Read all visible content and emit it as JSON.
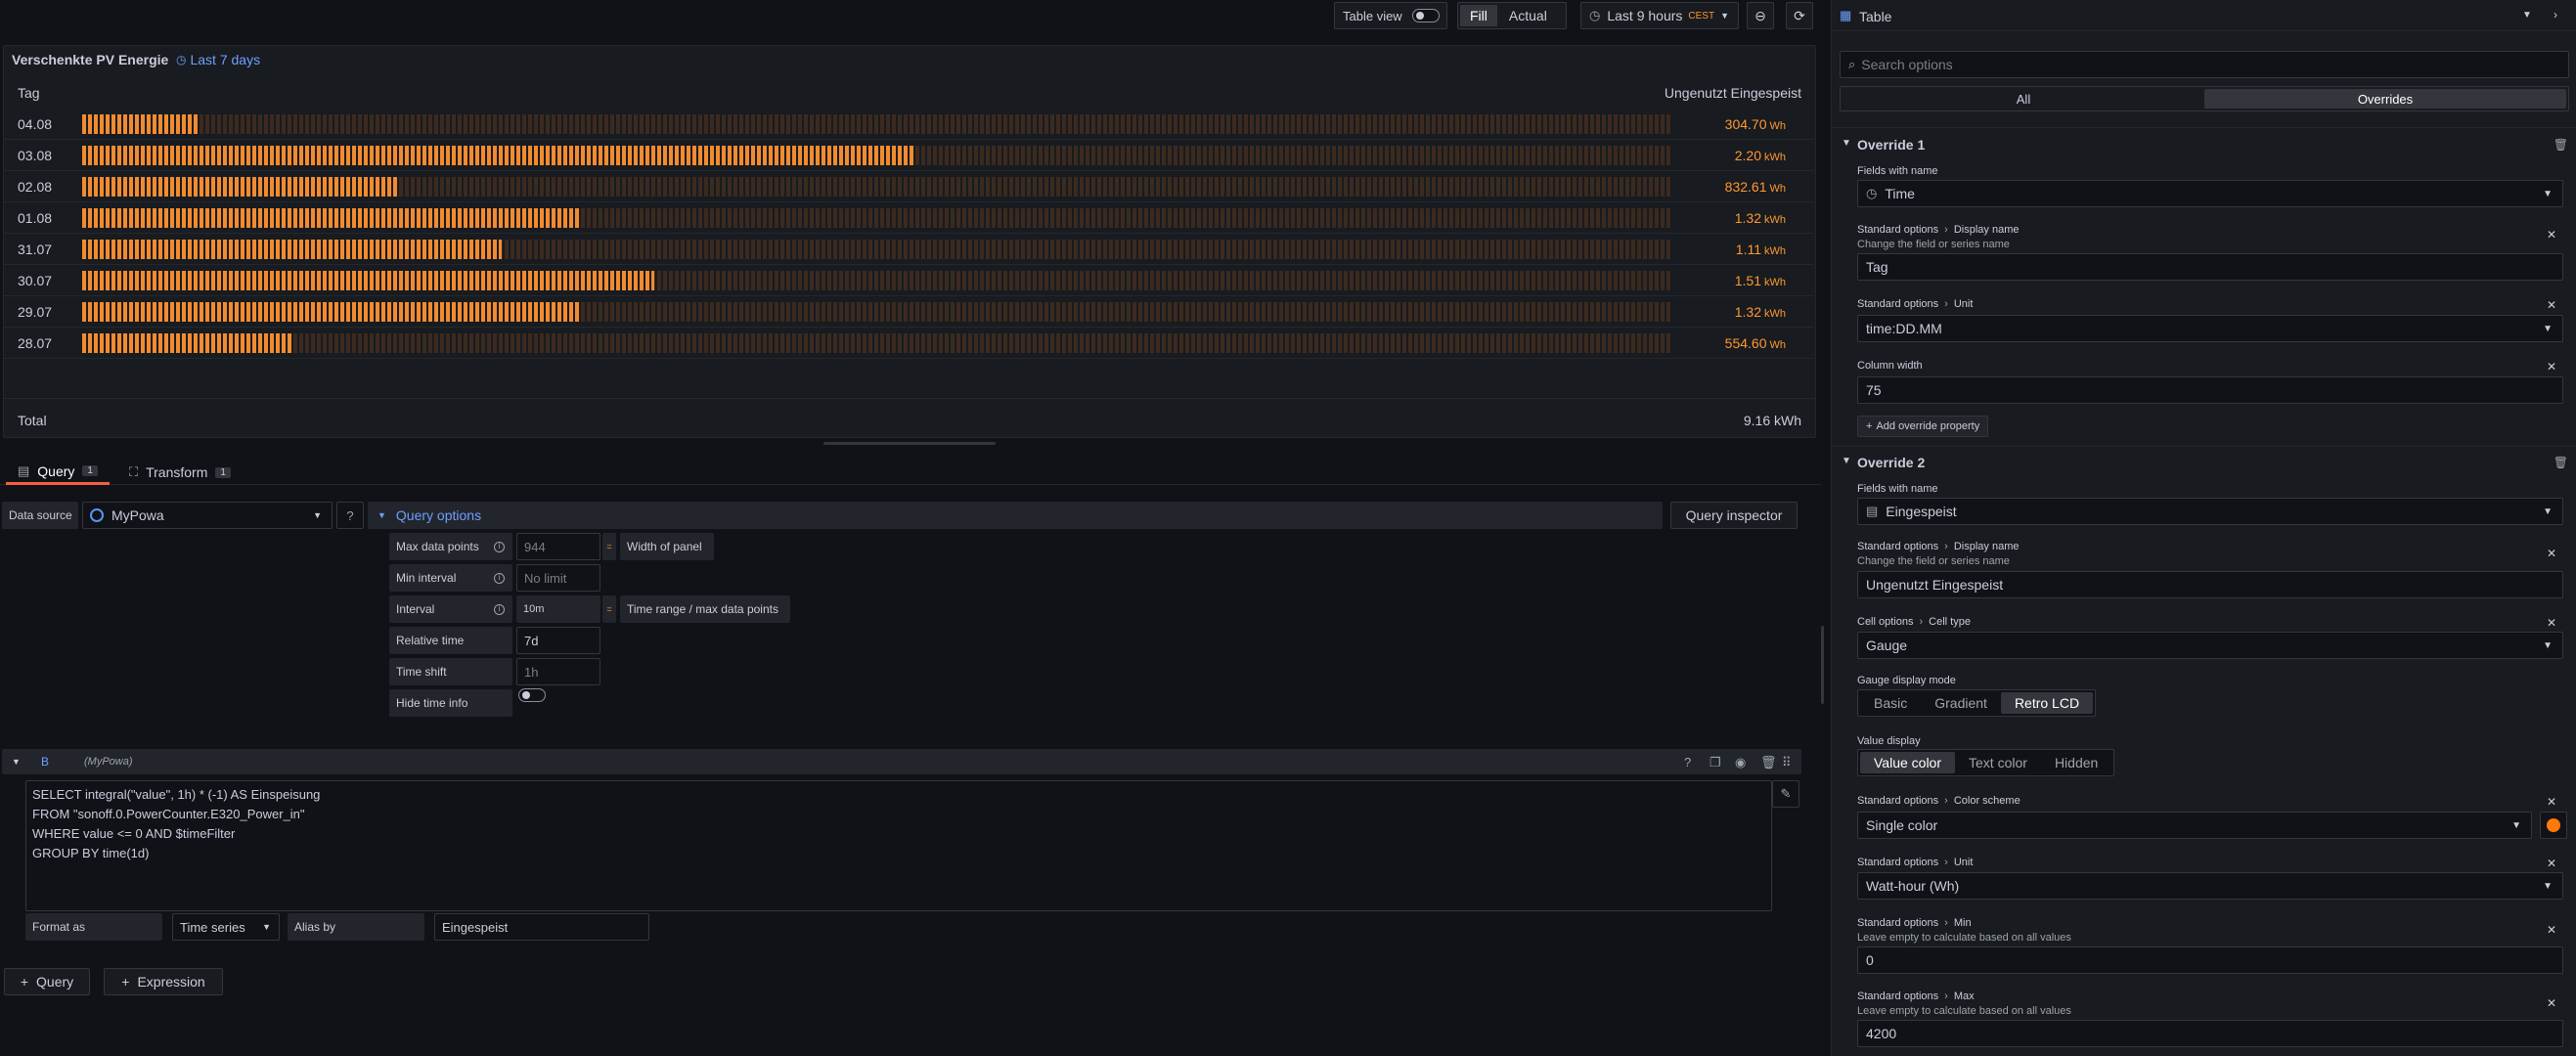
{
  "toolbar": {
    "table_view": "Table view",
    "fill": "Fill",
    "actual": "Actual",
    "time_range": "Last 9 hours",
    "tz": "CEST"
  },
  "panel": {
    "title": "Verschenkte PV Energie",
    "time_info": "Last 7 days",
    "col_tag": "Tag",
    "col_value": "Ungenutzt Eingespeist",
    "total_label": "Total",
    "total_value": "9.16 kWh",
    "rows": [
      {
        "tag": "04.08",
        "value": "304.70",
        "unit": "Wh",
        "fraction": 0.0725
      },
      {
        "tag": "03.08",
        "value": "2.20",
        "unit": "kWh",
        "fraction": 0.524
      },
      {
        "tag": "02.08",
        "value": "832.61",
        "unit": "Wh",
        "fraction": 0.198
      },
      {
        "tag": "01.08",
        "value": "1.32",
        "unit": "kWh",
        "fraction": 0.314
      },
      {
        "tag": "31.07",
        "value": "1.11",
        "unit": "kWh",
        "fraction": 0.264
      },
      {
        "tag": "30.07",
        "value": "1.51",
        "unit": "kWh",
        "fraction": 0.36
      },
      {
        "tag": "29.07",
        "value": "1.32",
        "unit": "kWh",
        "fraction": 0.314
      },
      {
        "tag": "28.07",
        "value": "554.60",
        "unit": "Wh",
        "fraction": 0.132
      }
    ]
  },
  "tabs": {
    "query": "Query",
    "query_count": "1",
    "transform": "Transform",
    "transform_count": "1"
  },
  "datasource": {
    "label": "Data source",
    "value": "MyPowa"
  },
  "query_options": {
    "title": "Query options",
    "inspector": "Query inspector",
    "max_data_points": "Max data points",
    "max_data_points_ph": "944",
    "width_of_panel": "Width of panel",
    "min_interval": "Min interval",
    "min_interval_ph": "No limit",
    "interval": "Interval",
    "interval_val": "10m",
    "interval_hint": "Time range / max data points",
    "relative_time": "Relative time",
    "relative_time_val": "7d",
    "time_shift": "Time shift",
    "time_shift_ph": "1h",
    "hide_time_info": "Hide time info"
  },
  "query_b": {
    "ref": "B",
    "ds": "(MyPowa)",
    "lines": [
      "SELECT integral(\"value\", 1h)  * (-1) AS Einspeisung",
      "FROM \"sonoff.0.PowerCounter.E320_Power_in\"",
      "WHERE value <= 0 AND $timeFilter",
      "GROUP BY time(1d)"
    ],
    "format_as": "Format as",
    "format_val": "Time series",
    "alias_by": "Alias by",
    "alias_val": "Eingespeist"
  },
  "add": {
    "query": "Query",
    "expression": "Expression"
  },
  "right": {
    "viz": "Table",
    "search_ph": "Search options",
    "tab_all": "All",
    "tab_overrides": "Overrides",
    "ov1": {
      "title": "Override 1",
      "fields_label": "Fields with name",
      "fields_val": "Time",
      "p1_cat": "Standard options",
      "p1_name": "Display name",
      "p1_desc": "Change the field or series name",
      "p1_val": "Tag",
      "p2_cat": "Standard options",
      "p2_name": "Unit",
      "p2_val": "time:DD.MM",
      "p3_name": "Column width",
      "p3_val": "75",
      "add_prop": "Add override property"
    },
    "ov2": {
      "title": "Override 2",
      "fields_label": "Fields with name",
      "fields_val": "Eingespeist",
      "p1_cat": "Standard options",
      "p1_name": "Display name",
      "p1_desc": "Change the field or series name",
      "p1_val": "Ungenutzt Eingespeist",
      "p2_cat": "Cell options",
      "p2_name": "Cell type",
      "p2_val": "Gauge",
      "gauge_mode": "Gauge display mode",
      "gm": [
        "Basic",
        "Gradient",
        "Retro LCD"
      ],
      "value_display": "Value display",
      "vd": [
        "Value color",
        "Text color",
        "Hidden"
      ],
      "p3_cat": "Standard options",
      "p3_name": "Color scheme",
      "p3_val": "Single color",
      "color": "#ff780a",
      "p4_cat": "Standard options",
      "p4_name": "Unit",
      "p4_val": "Watt-hour (Wh)",
      "p5_cat": "Standard options",
      "p5_name": "Min",
      "p5_desc": "Leave empty to calculate based on all values",
      "p5_val": "0",
      "p6_cat": "Standard options",
      "p6_name": "Max",
      "p6_desc": "Leave empty to calculate based on all values",
      "p6_val": "4200"
    }
  }
}
